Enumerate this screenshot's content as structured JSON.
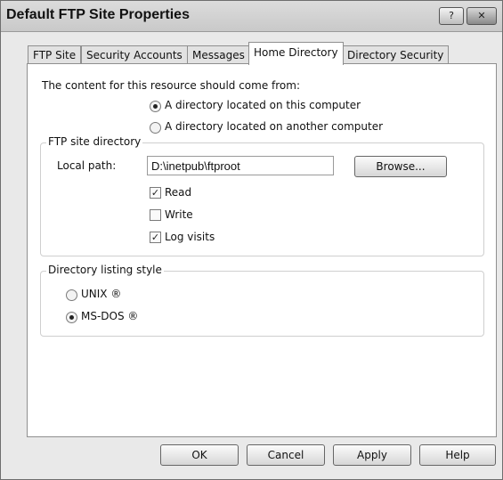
{
  "window": {
    "title": "Default FTP Site Properties",
    "help_glyph": "?",
    "close_glyph": "✕"
  },
  "tabs": [
    {
      "label": "FTP Site",
      "active": false
    },
    {
      "label": "Security Accounts",
      "active": false
    },
    {
      "label": "Messages",
      "active": false
    },
    {
      "label": "Home Directory",
      "active": true
    },
    {
      "label": "Directory Security",
      "active": false
    }
  ],
  "content_source": {
    "prompt": "The content for this resource should come from:",
    "options": [
      {
        "label": "A directory located on this computer",
        "selected": true
      },
      {
        "label": "A directory located on another computer",
        "selected": false
      }
    ]
  },
  "ftp_site_directory": {
    "legend": "FTP site directory",
    "local_path_label": "Local path:",
    "local_path_value": "D:\\inetpub\\ftproot",
    "browse_label": "Browse...",
    "permissions": [
      {
        "label": "Read",
        "checked": true
      },
      {
        "label": "Write",
        "checked": false
      },
      {
        "label": "Log visits",
        "checked": true
      }
    ]
  },
  "listing_style": {
    "legend": "Directory listing style",
    "options": [
      {
        "label": "UNIX ®",
        "selected": false
      },
      {
        "label": "MS-DOS ®",
        "selected": true
      }
    ]
  },
  "footer_buttons": {
    "ok": "OK",
    "cancel": "Cancel",
    "apply": "Apply",
    "help": "Help"
  },
  "check_glyph": "✓"
}
